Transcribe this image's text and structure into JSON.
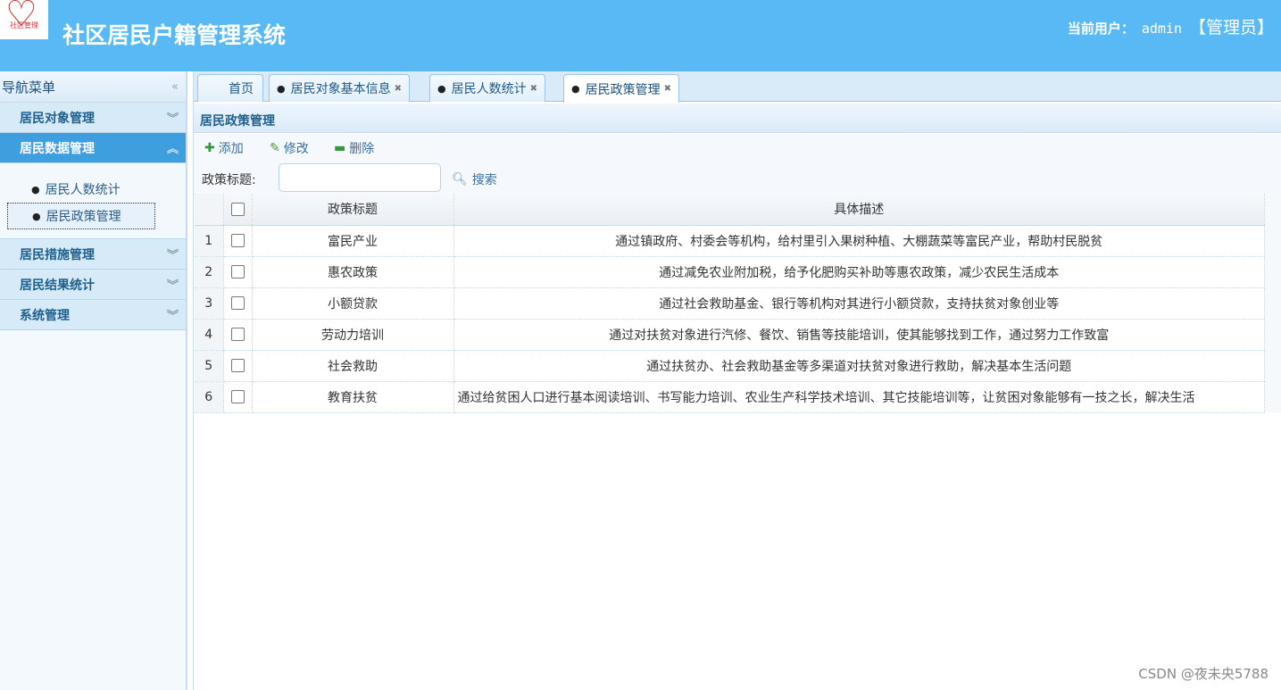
{
  "header": {
    "logo_text": "社区管理",
    "title": "社区居民户籍管理系统",
    "user_label": "当前用户：",
    "username": "admin",
    "role": "【管理员】"
  },
  "sidebar": {
    "title": "导航菜单",
    "collapse_icon": "«",
    "groups": [
      {
        "label": "居民对象管理"
      },
      {
        "label": "居民数据管理",
        "items": [
          {
            "label": "居民人数统计"
          },
          {
            "label": "居民政策管理"
          }
        ]
      },
      {
        "label": "居民措施管理"
      },
      {
        "label": "居民结果统计"
      },
      {
        "label": "系统管理"
      }
    ]
  },
  "tabs": [
    {
      "label": "首页"
    },
    {
      "label": "居民对象基本信息"
    },
    {
      "label": "居民人数统计"
    },
    {
      "label": "居民政策管理"
    }
  ],
  "panel": {
    "title": "居民政策管理"
  },
  "toolbar": {
    "add": "添加",
    "edit": "修改",
    "delete": "删除",
    "search_label": "政策标题:",
    "search_value": "",
    "search_button": "搜索"
  },
  "table": {
    "columns": [
      "政策标题",
      "具体描述"
    ],
    "rows": [
      {
        "n": "1",
        "title": "富民产业",
        "desc": "通过镇政府、村委会等机构，给村里引入果树种植、大棚蔬菜等富民产业，帮助村民脱贫"
      },
      {
        "n": "2",
        "title": "惠农政策",
        "desc": "通过减免农业附加税，给予化肥购买补助等惠农政策，减少农民生活成本"
      },
      {
        "n": "3",
        "title": "小额贷款",
        "desc": "通过社会救助基金、银行等机构对其进行小额贷款，支持扶贫对象创业等"
      },
      {
        "n": "4",
        "title": "劳动力培训",
        "desc": "通过对扶贫对象进行汽修、餐饮、销售等技能培训，使其能够找到工作，通过努力工作致富"
      },
      {
        "n": "5",
        "title": "社会救助",
        "desc": "通过扶贫办、社会救助基金等多渠道对扶贫对象进行救助，解决基本生活问题"
      },
      {
        "n": "6",
        "title": "教育扶贫",
        "desc": "通过给贫困人口进行基本阅读培训、书写能力培训、农业生产科学技术培训、其它技能培训等，让贫困对象能够有一技之长，解决生活"
      }
    ]
  },
  "watermark": "CSDN @夜未央5788"
}
